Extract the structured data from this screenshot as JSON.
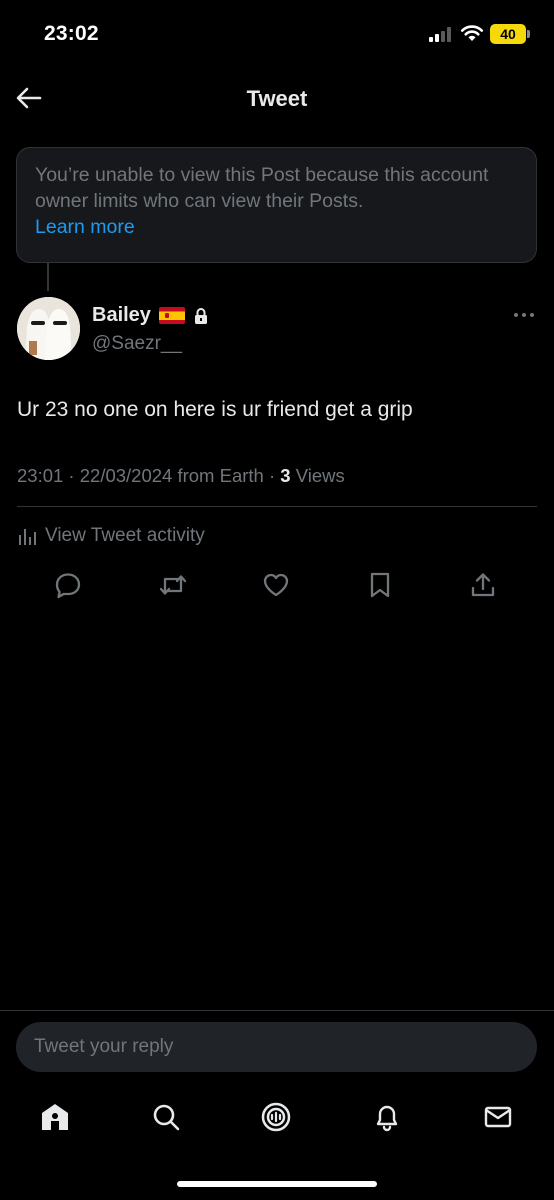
{
  "status_bar": {
    "time": "23:02",
    "battery": "40"
  },
  "header": {
    "title": "Tweet"
  },
  "notice": {
    "text": "You’re unable to view this Post because this account owner limits who can view their Posts.",
    "link": "Learn more"
  },
  "tweet": {
    "author_name": "Bailey",
    "author_handle": "@Saezr__",
    "text": "Ur 23 no one on here is ur friend get a grip",
    "timestamp": "23:01 · 22/03/2024 from Earth · ",
    "views_count": "3",
    "views_label": " Views"
  },
  "activity": {
    "label": "View Tweet activity"
  },
  "reply": {
    "placeholder": "Tweet your reply"
  },
  "icons": {
    "actions": [
      "reply-icon",
      "retweet-icon",
      "like-icon",
      "bookmark-icon",
      "share-icon"
    ],
    "tabs": [
      "home-icon",
      "search-icon",
      "spaces-icon",
      "notifications-icon",
      "messages-icon"
    ]
  },
  "colors": {
    "accent": "#1d9bf0",
    "background": "#000000",
    "muted": "#71767b",
    "battery": "#f5d90a"
  }
}
